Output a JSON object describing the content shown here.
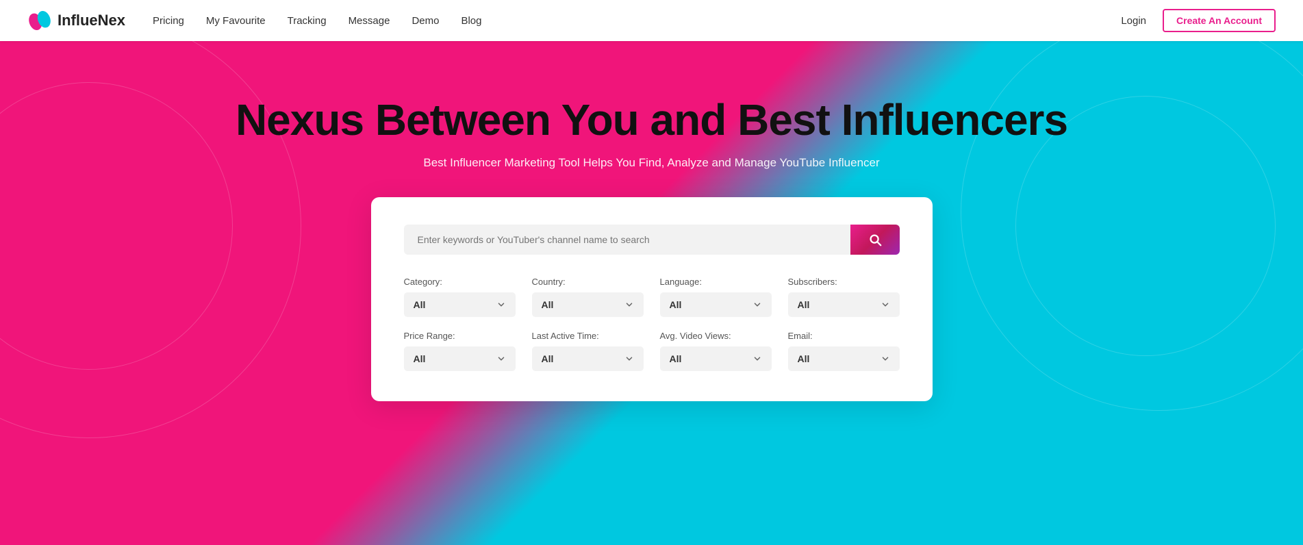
{
  "navbar": {
    "logo_text": "InflueNex",
    "nav_links": [
      {
        "id": "pricing",
        "label": "Pricing"
      },
      {
        "id": "my-favourite",
        "label": "My Favourite"
      },
      {
        "id": "tracking",
        "label": "Tracking"
      },
      {
        "id": "message",
        "label": "Message"
      },
      {
        "id": "demo",
        "label": "Demo"
      },
      {
        "id": "blog",
        "label": "Blog"
      }
    ],
    "login_label": "Login",
    "create_account_label": "Create An Account"
  },
  "hero": {
    "title_part1": "Nexus Between You and ",
    "title_part2": "Best Influencers",
    "subtitle": "Best Influencer Marketing Tool Helps You Find, Analyze and Manage YouTube Influencer",
    "search_placeholder": "Enter keywords or YouTuber's channel name to search",
    "filters": {
      "row1": [
        {
          "id": "category",
          "label": "Category:",
          "value": "All"
        },
        {
          "id": "country",
          "label": "Country:",
          "value": "All"
        },
        {
          "id": "language",
          "label": "Language:",
          "value": "All"
        },
        {
          "id": "subscribers",
          "label": "Subscribers:",
          "value": "All"
        }
      ],
      "row2": [
        {
          "id": "price-range",
          "label": "Price Range:",
          "value": "All"
        },
        {
          "id": "last-active-time",
          "label": "Last Active Time:",
          "value": "All"
        },
        {
          "id": "avg-video-views",
          "label": "Avg. Video Views:",
          "value": "All"
        },
        {
          "id": "email",
          "label": "Email:",
          "value": "All"
        }
      ]
    }
  },
  "colors": {
    "pink": "#f0157a",
    "cyan": "#00c8e0",
    "accent_gradient_start": "#e91e8c",
    "accent_gradient_end": "#9c27b0"
  }
}
